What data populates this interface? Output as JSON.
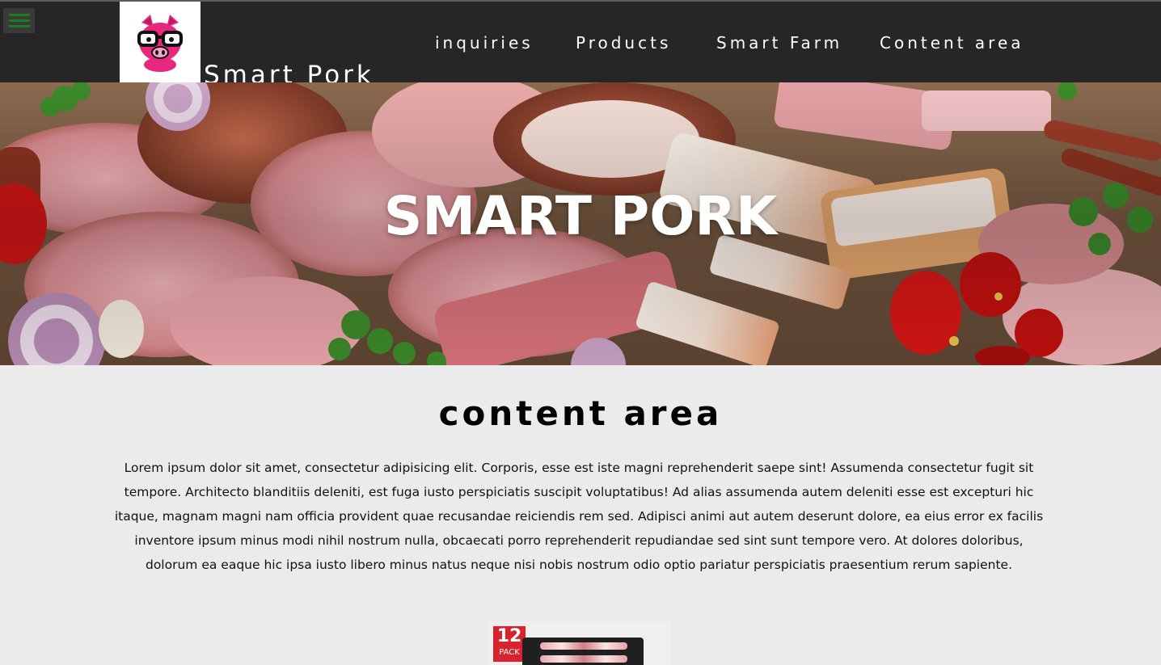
{
  "navbar": {
    "brand": "Smart Pork",
    "nav_items": [
      "inquiries",
      "Products",
      "Smart Farm",
      "Content area"
    ]
  },
  "hero": {
    "title": "SMART PORK"
  },
  "content": {
    "heading": "content area",
    "body": "Lorem ipsum dolor sit amet, consectetur adipisicing elit. Corporis, esse est iste magni reprehenderit saepe sint! Assumenda consectetur fugit sit tempore. Architecto blanditiis deleniti, est fuga iusto perspiciatis suscipit voluptatibus! Ad alias assumenda autem deleniti esse est excepturi hic itaque, magnam magni nam officia provident quae recusandae reiciendis rem sed. Adipisci animi aut autem deserunt dolore, ea eius error ex facilis inventore ipsum minus modi nihil nostrum nulla, obcaecati porro reprehenderit repudiandae sed sint sunt tempore vero. At dolores doloribus, dolorum ea eaque hic ipsa iusto libero minus natus neque nisi nobis nostrum odio optio pariatur perspiciatis praesentium rerum sapiente."
  },
  "product": {
    "pack_number": "12",
    "pack_label": "PACK"
  },
  "icons": {
    "menu": "hamburger-menu-icon",
    "logo": "pig-with-glasses-logo"
  },
  "colors": {
    "navbar_bg": "#262626",
    "menu_accent": "#1f7a1f",
    "logo_pink": "#e8287e",
    "page_bg": "#ebebeb"
  }
}
